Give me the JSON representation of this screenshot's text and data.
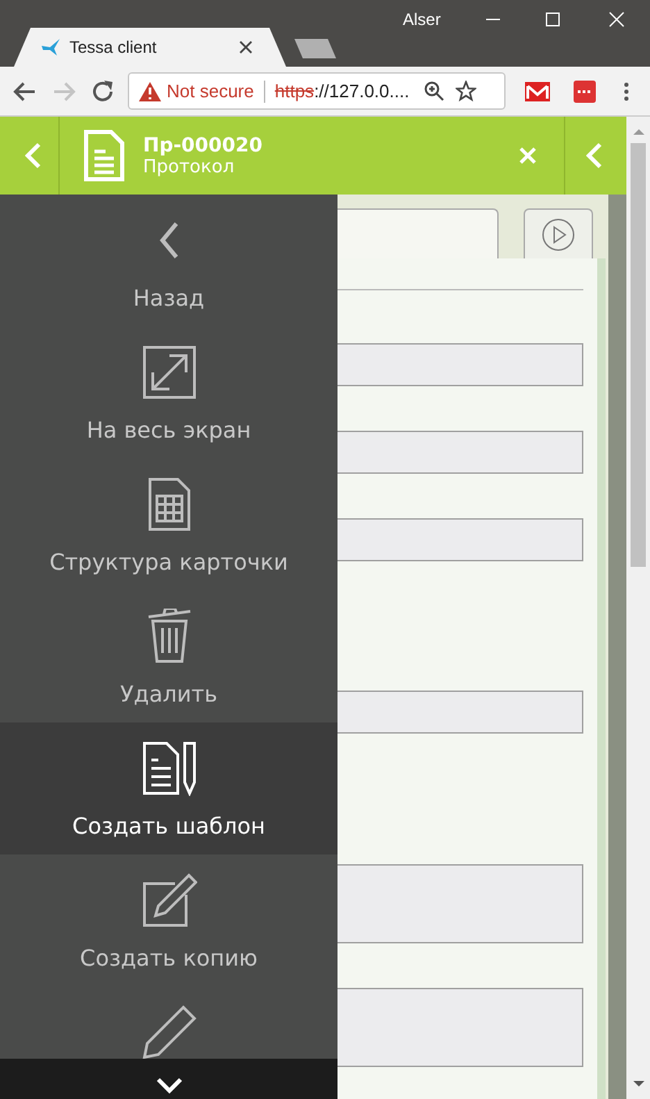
{
  "browser": {
    "user": "Alser",
    "tab_title": "Tessa client",
    "forward_disabled": true,
    "address": {
      "security": "Not secure",
      "scheme": "https",
      "rest": "://127.0.0...."
    }
  },
  "header": {
    "title": "Пр-000020",
    "subtitle": "Протокол"
  },
  "menu": {
    "items": [
      {
        "label": "Назад",
        "selected": false
      },
      {
        "label": "На весь экран",
        "selected": false
      },
      {
        "label": "Структура карточки",
        "selected": false
      },
      {
        "label": "Удалить",
        "selected": false
      },
      {
        "label": "Создать шаблон",
        "selected": true
      },
      {
        "label": "Создать копию",
        "selected": false
      },
      {
        "selected": false
      }
    ]
  }
}
